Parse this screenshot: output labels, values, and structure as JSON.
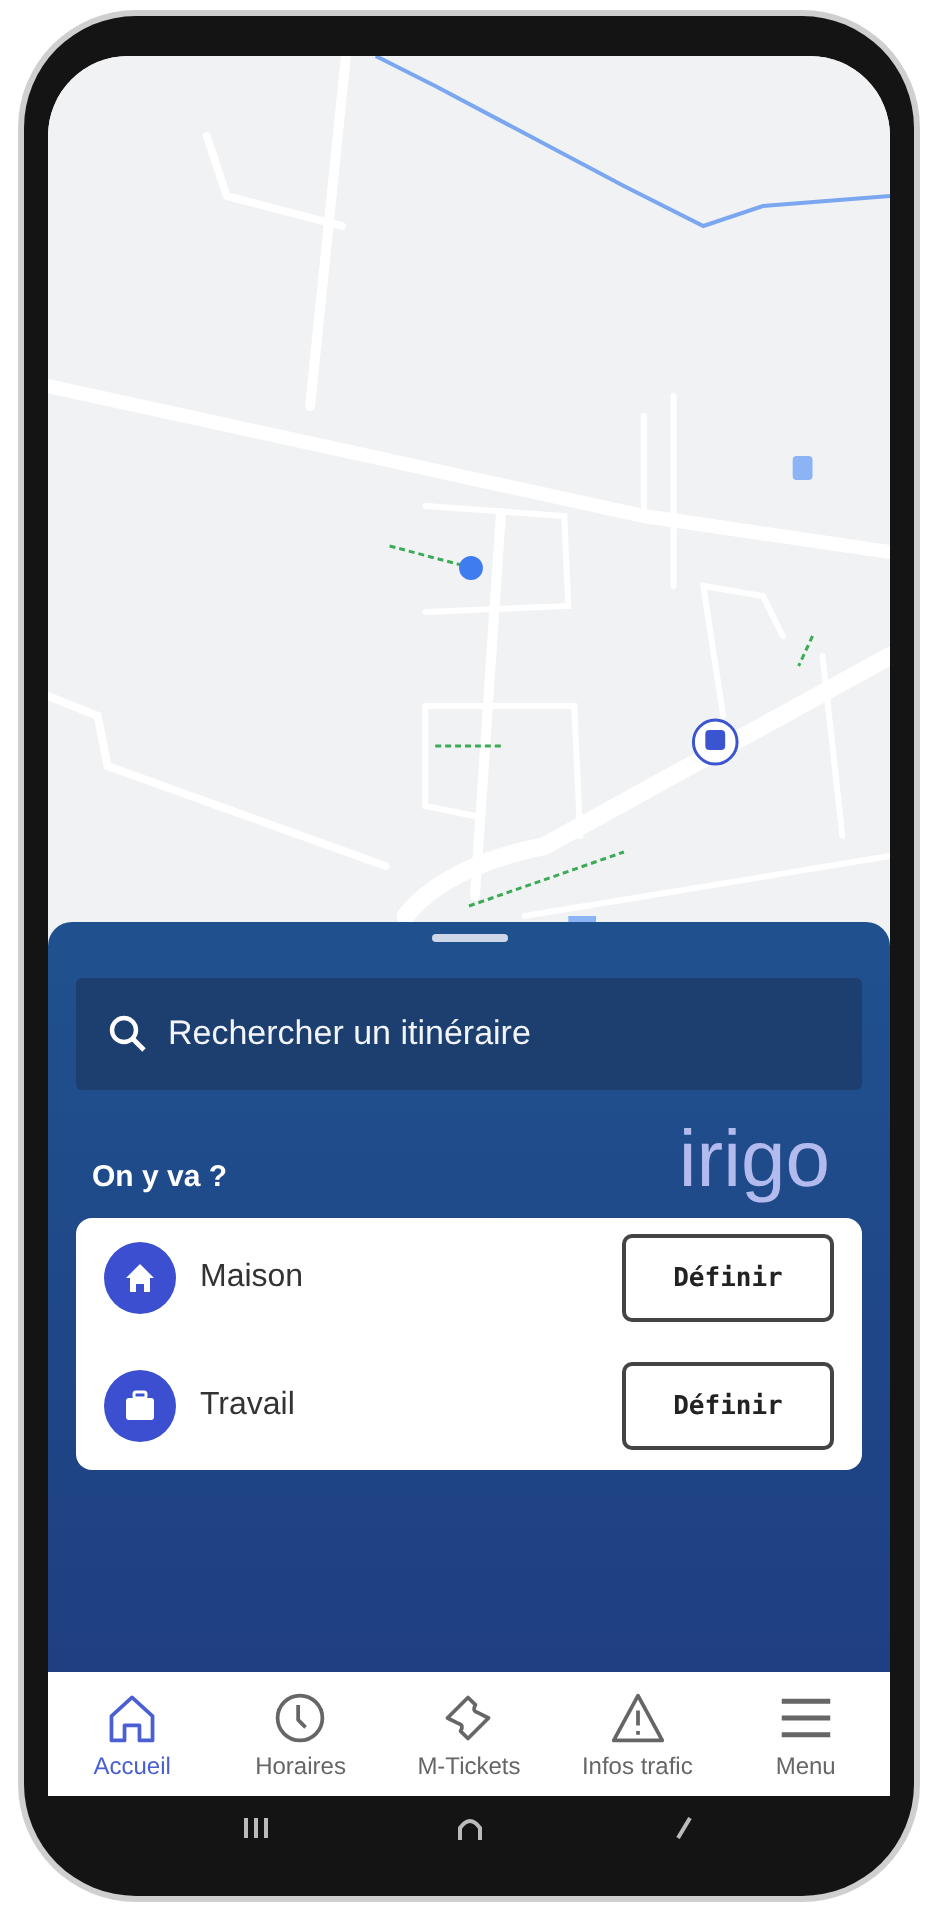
{
  "search": {
    "placeholder": "Rechercher un itinéraire"
  },
  "section_title": "On y va ?",
  "logo_text": "irigo",
  "places": [
    {
      "kind": "home",
      "label": "Maison",
      "action": "Définir"
    },
    {
      "kind": "work",
      "label": "Travail",
      "action": "Définir"
    }
  ],
  "nav": [
    {
      "kind": "home",
      "label": "Accueil",
      "selected": true
    },
    {
      "kind": "clock",
      "label": "Horaires",
      "selected": false
    },
    {
      "kind": "ticket",
      "label": "M-Tickets",
      "selected": false
    },
    {
      "kind": "warning",
      "label": "Infos trafic",
      "selected": false
    },
    {
      "kind": "menu",
      "label": "Menu",
      "selected": false
    }
  ]
}
